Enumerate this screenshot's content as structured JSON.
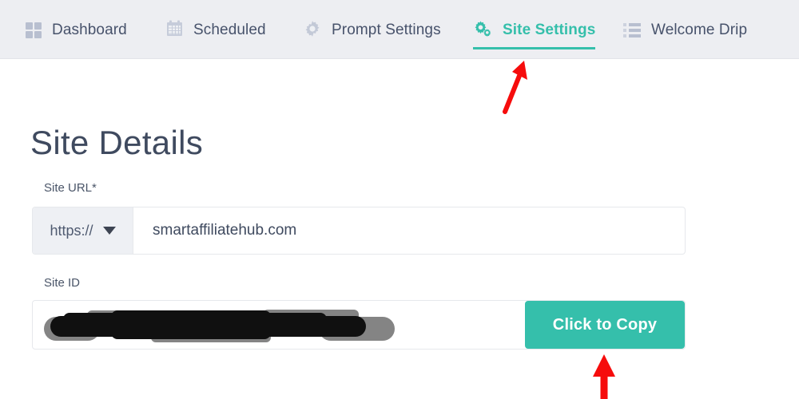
{
  "nav": {
    "items": [
      {
        "label": "Dashboard",
        "icon": "grid-icon",
        "active": false
      },
      {
        "label": "Scheduled",
        "icon": "calendar-icon",
        "active": false
      },
      {
        "label": "Prompt Settings",
        "icon": "gear-icon",
        "active": false
      },
      {
        "label": "Site Settings",
        "icon": "double-gear-icon",
        "active": true
      },
      {
        "label": "Welcome Drip",
        "icon": "list-icon",
        "active": false
      }
    ],
    "active_label": "Site Settings"
  },
  "page": {
    "title": "Site Details"
  },
  "form": {
    "site_url": {
      "label": "Site URL*",
      "protocol": "https://",
      "value": "smartaffiliatehub.com",
      "placeholder": "example.com"
    },
    "site_id": {
      "label": "Site ID",
      "value": "",
      "redacted": true,
      "copy_button_label": "Click to Copy"
    }
  },
  "annotations": [
    {
      "name": "arrow-to-site-settings-tab",
      "color": "#f60c0c",
      "direction": "up-right"
    },
    {
      "name": "arrow-to-click-to-copy",
      "color": "#f60c0c",
      "direction": "up"
    }
  ],
  "colors": {
    "accent": "#35bfab",
    "navbar_bg": "#edeef2",
    "nav_text": "#47526b",
    "icon_gray": "#b8bfd0",
    "annotation_red": "#f60c0c",
    "heading": "#3f4a5f",
    "field_border": "#e6e8ec",
    "prefix_bg": "#eef0f4"
  }
}
